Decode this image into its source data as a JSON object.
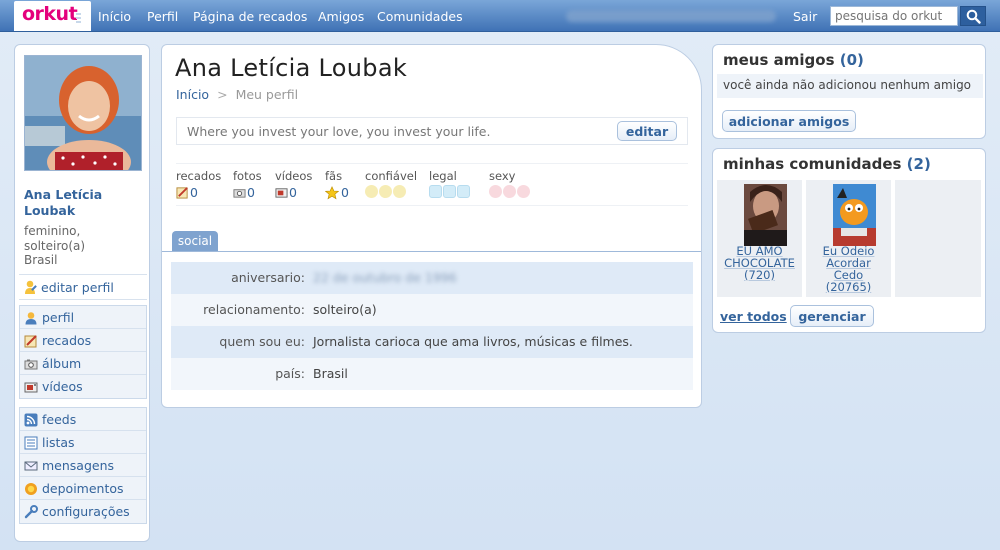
{
  "brand": {
    "logo_text": "orkut"
  },
  "nav": {
    "items": [
      "Início",
      "Perfil",
      "Página de recados",
      "Amigos",
      "Comunidades"
    ],
    "logout": "Sair"
  },
  "search": {
    "placeholder": "pesquisa do orkut",
    "icon": "search-icon"
  },
  "sidebar": {
    "name_line1": "Ana Letícia",
    "name_line2": "Loubak",
    "meta": [
      "feminino,",
      "solteiro(a)",
      "Brasil"
    ],
    "edit_label": "editar perfil",
    "menu1": [
      {
        "label": "perfil",
        "icon": "user-icon"
      },
      {
        "label": "recados",
        "icon": "scrap-icon"
      },
      {
        "label": "álbum",
        "icon": "camera-icon"
      },
      {
        "label": "vídeos",
        "icon": "video-icon"
      }
    ],
    "menu2": [
      {
        "label": "feeds",
        "icon": "rss-icon"
      },
      {
        "label": "listas",
        "icon": "list-icon"
      },
      {
        "label": "mensagens",
        "icon": "envelope-icon"
      },
      {
        "label": "depoimentos",
        "icon": "sun-icon"
      },
      {
        "label": "configurações",
        "icon": "wrench-icon"
      }
    ]
  },
  "profile": {
    "title": "Ana Letícia Loubak",
    "breadcrumb": {
      "home": "Início",
      "separator": ">",
      "current": "Meu perfil"
    },
    "status_text": "Where you invest your love, you invest your life.",
    "edit_button": "editar",
    "stats": [
      {
        "label": "recados",
        "value": "0",
        "icon": "scrap-icon"
      },
      {
        "label": "fotos",
        "value": "0",
        "icon": "camera-icon"
      },
      {
        "label": "vídeos",
        "value": "0",
        "icon": "video-icon"
      },
      {
        "label": "fãs",
        "value": "0",
        "icon": "star-icon"
      }
    ],
    "ratings": [
      {
        "label": "confiável",
        "icon": "smiley-icon",
        "color": "#f6ecb4",
        "level": 0
      },
      {
        "label": "legal",
        "icon": "ice-cube-icon",
        "color": "#d3ecf8",
        "level": 0
      },
      {
        "label": "sexy",
        "icon": "heart-icon",
        "color": "#f8d9de",
        "level": 0
      }
    ],
    "tab_label": "social",
    "fields": [
      {
        "key": "aniversario:",
        "value": "22 de outubro de 1996"
      },
      {
        "key": "relacionamento:",
        "value": "solteiro(a)"
      },
      {
        "key": "quem sou eu:",
        "value": "Jornalista carioca que ama livros, músicas e filmes."
      },
      {
        "key": "país:",
        "value": "Brasil"
      }
    ]
  },
  "friends": {
    "heading": "meus amigos",
    "count": "(0)",
    "empty_note": "você ainda não adicionou nenhum amigo",
    "add_button": "adicionar amigos"
  },
  "communities": {
    "heading": "minhas comunidades",
    "count": "(2)",
    "items": [
      {
        "line1": "EU AMO",
        "line2": "CHOCOLATE",
        "line3": "(720)"
      },
      {
        "line1": "Eu Odeio",
        "line2": "Acordar",
        "line3": "Cedo",
        "line4": "(20765)"
      }
    ],
    "see_all": "ver todos",
    "manage_button": "gerenciar"
  },
  "colors": {
    "accent": "#34649c",
    "topbar": "#3f72b5",
    "logo": "#e4007c"
  }
}
